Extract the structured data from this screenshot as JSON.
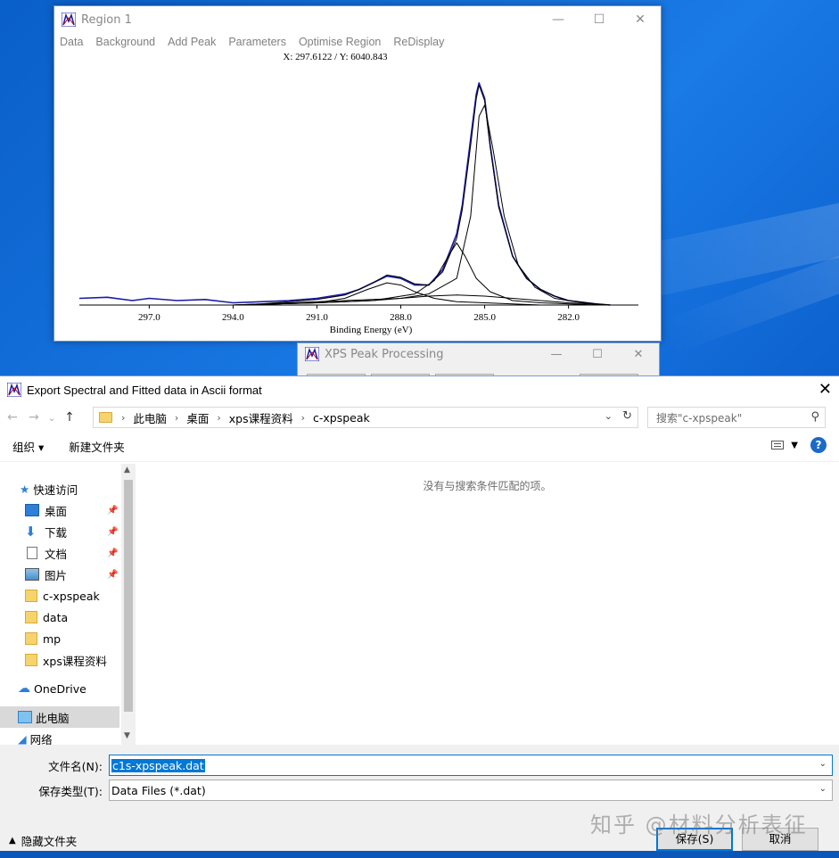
{
  "region_window": {
    "title": "Region 1",
    "menu": [
      "Data",
      "Background",
      "Add Peak",
      "Parameters",
      "Optimise Region",
      "ReDisplay"
    ],
    "cursor_readout": "X: 297.6122 / Y: 6040.843",
    "controls": {
      "minimize": "—",
      "maximize": "☐",
      "close": "✕"
    }
  },
  "chart_data": {
    "type": "line",
    "xlabel": "Binding Energy (eV)",
    "x_ticks": [
      "297.0",
      "294.0",
      "291.0",
      "288.0",
      "285.0",
      "282.0"
    ],
    "xlim": [
      299.5,
      279.5
    ],
    "ylim": [
      0,
      1
    ],
    "x_reversed": true,
    "grid": false,
    "series": [
      {
        "color": "#1a1aa8",
        "x": [
          299.5,
          298.5,
          297.6,
          297,
          296,
          295,
          294,
          293,
          292,
          291,
          290,
          289.5,
          289,
          288.5,
          288,
          287.5,
          287,
          286.5,
          286,
          285.8,
          285.5,
          285.3,
          285.2,
          285,
          284.8,
          284.5,
          284,
          283.5,
          283,
          282.5,
          282,
          281,
          280.5
        ],
        "y": [
          0.03,
          0.035,
          0.02,
          0.03,
          0.02,
          0.025,
          0.01,
          0.015,
          0.02,
          0.03,
          0.05,
          0.07,
          0.1,
          0.13,
          0.12,
          0.09,
          0.09,
          0.16,
          0.32,
          0.45,
          0.75,
          0.95,
          1.0,
          0.93,
          0.72,
          0.45,
          0.22,
          0.12,
          0.07,
          0.04,
          0.02,
          0.005,
          0.0
        ]
      },
      {
        "color": "#000000",
        "x": [
          294,
          293,
          292,
          291,
          290,
          289.5,
          289,
          288.5,
          288,
          287.5,
          287,
          286.5,
          286,
          285.8,
          285.5,
          285.3,
          285.2,
          285,
          284.8,
          284.5,
          284,
          283.5,
          283,
          282.5,
          282,
          281,
          280.5
        ],
        "y": [
          0.0,
          0.005,
          0.015,
          0.025,
          0.045,
          0.07,
          0.1,
          0.135,
          0.125,
          0.095,
          0.09,
          0.15,
          0.3,
          0.43,
          0.72,
          0.93,
          0.99,
          0.92,
          0.71,
          0.44,
          0.22,
          0.12,
          0.07,
          0.04,
          0.02,
          0.005,
          0.0
        ]
      },
      {
        "color": "#000000",
        "x": [
          294,
          291,
          289,
          288,
          287,
          286,
          285.5,
          285.2,
          285,
          284.7,
          284.3,
          283.8,
          283.2,
          282.5,
          281.5,
          280.5
        ],
        "y": [
          0.0,
          0.01,
          0.02,
          0.03,
          0.05,
          0.12,
          0.4,
          0.85,
          0.9,
          0.7,
          0.4,
          0.18,
          0.08,
          0.03,
          0.01,
          0.0
        ]
      },
      {
        "color": "#000000",
        "x": [
          294,
          291,
          289,
          287.5,
          286.8,
          286.3,
          286,
          285.7,
          285.3,
          284.8,
          284,
          283,
          281,
          280.5
        ],
        "y": [
          0.0,
          0.01,
          0.02,
          0.05,
          0.11,
          0.22,
          0.28,
          0.22,
          0.12,
          0.06,
          0.02,
          0.01,
          0.0,
          0.0
        ]
      },
      {
        "color": "#000000",
        "x": [
          294,
          291,
          290,
          289.2,
          288.5,
          288,
          287.5,
          286.8,
          286,
          285,
          283,
          280.5
        ],
        "y": [
          0.0,
          0.01,
          0.03,
          0.07,
          0.1,
          0.09,
          0.06,
          0.03,
          0.015,
          0.01,
          0.0,
          0.0
        ]
      },
      {
        "color": "#000000",
        "x": [
          294,
          292,
          290,
          288,
          287,
          286,
          285,
          284,
          283,
          282,
          280.5
        ],
        "y": [
          0.0,
          0.01,
          0.02,
          0.03,
          0.04,
          0.045,
          0.04,
          0.03,
          0.02,
          0.01,
          0.0
        ]
      }
    ]
  },
  "xps_window": {
    "title": "XPS Peak Processing",
    "controls": {
      "minimize": "—",
      "maximize": "☐",
      "close": "✕"
    }
  },
  "dialog": {
    "title": "Export Spectral and Fitted data in Ascii format",
    "close": "✕",
    "nav": {
      "back": "←",
      "forward": "→",
      "recent": "⌄",
      "up": "↑"
    },
    "breadcrumb": [
      "此电脑",
      "桌面",
      "xps课程资料",
      "c-xpspeak"
    ],
    "search_placeholder": "搜索\"c-xpspeak\"",
    "toolbar": {
      "organize": "组织 ▾",
      "new_folder": "新建文件夹",
      "help": "?"
    },
    "nav_items": [
      {
        "label": "快速访问"
      },
      {
        "label": "桌面"
      },
      {
        "label": "下载"
      },
      {
        "label": "文档"
      },
      {
        "label": "图片"
      },
      {
        "label": "c-xpspeak"
      },
      {
        "label": "data"
      },
      {
        "label": "mp"
      },
      {
        "label": "xps课程资料"
      },
      {
        "label": "OneDrive"
      },
      {
        "label": "此电脑"
      },
      {
        "label": "网络"
      }
    ],
    "empty_message": "没有与搜索条件匹配的项。",
    "filename_label": "文件名(N):",
    "filename_value": "c1s-xpspeak.dat",
    "filetype_label": "保存类型(T):",
    "filetype_value": "Data Files (*.dat)",
    "hide_folders": "隐藏文件夹",
    "save_label": "保存(S)",
    "cancel_label": "取消"
  },
  "watermark": "知乎 @材料分析表征"
}
